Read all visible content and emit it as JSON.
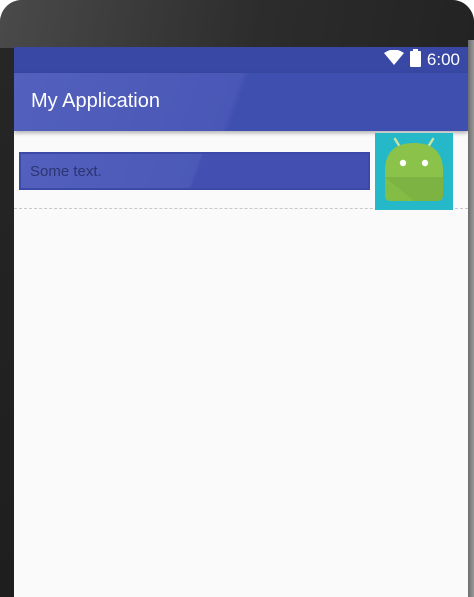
{
  "status_bar": {
    "time": "6:00",
    "icons": [
      "wifi-icon",
      "battery-icon"
    ],
    "color": "#3848a4"
  },
  "app_bar": {
    "title": "My Application",
    "color": "#3f51b5"
  },
  "content": {
    "text_field_value": "Some text.",
    "image": "android-launcher-icon",
    "image_background": "#24b8c9"
  }
}
